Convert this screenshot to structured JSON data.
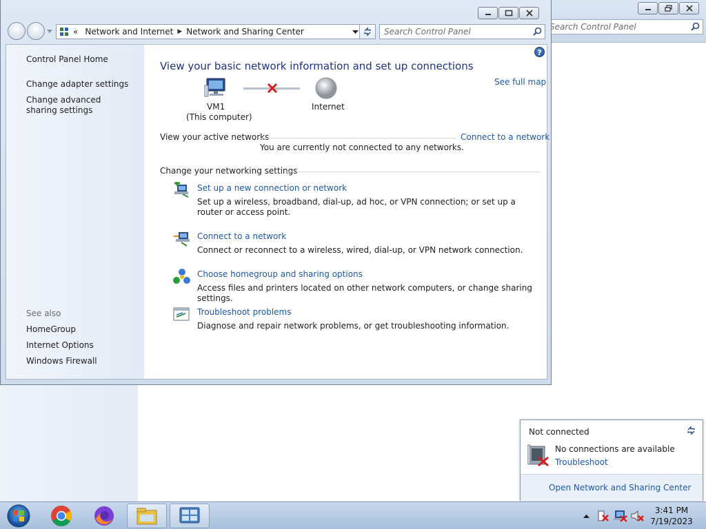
{
  "background_window": {
    "search_placeholder": "Search Control Panel"
  },
  "window": {
    "breadcrumb": {
      "overflow": "«",
      "items": [
        "Network and Internet",
        "Network and Sharing Center"
      ]
    },
    "search_placeholder": "Search Control Panel"
  },
  "left_pane": {
    "home": "Control Panel Home",
    "links": [
      "Change adapter settings",
      "Change advanced sharing settings"
    ],
    "see_also_label": "See also",
    "see_also": [
      "HomeGroup",
      "Internet Options",
      "Windows Firewall"
    ]
  },
  "main": {
    "title": "View your basic network information and set up connections",
    "see_full_map": "See full map",
    "computer_name": "VM1",
    "computer_sub": "(This computer)",
    "internet_label": "Internet",
    "active_networks_label": "View your active networks",
    "connect_link": "Connect to a network",
    "not_connected_msg": "You are currently not connected to any networks.",
    "change_settings_label": "Change your networking settings",
    "tasks": [
      {
        "title": "Set up a new connection or network",
        "desc": "Set up a wireless, broadband, dial-up, ad hoc, or VPN connection; or set up a router or access point.",
        "icon": "new-connection-icon"
      },
      {
        "title": "Connect to a network",
        "desc": "Connect or reconnect to a wireless, wired, dial-up, or VPN network connection.",
        "icon": "connect-network-icon"
      },
      {
        "title": "Choose homegroup and sharing options",
        "desc": "Access files and printers located on other network computers, or change sharing settings.",
        "icon": "homegroup-icon"
      },
      {
        "title": "Troubleshoot problems",
        "desc": "Diagnose and repair network problems, or get troubleshooting information.",
        "icon": "troubleshoot-icon"
      }
    ]
  },
  "flyout": {
    "status": "Not connected",
    "message": "No connections are available",
    "troubleshoot": "Troubleshoot",
    "open_center": "Open Network and Sharing Center"
  },
  "clock": {
    "time": "3:41 PM",
    "date": "7/19/2023"
  },
  "colors": {
    "link": "#1c58a8",
    "title": "#1e3287",
    "error_x": "#d42020"
  }
}
